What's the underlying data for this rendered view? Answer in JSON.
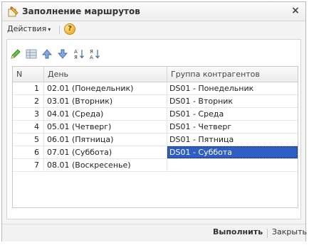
{
  "window": {
    "title": "Заполнение маршрутов",
    "close_glyph": "×",
    "icon": "route-fill-icon"
  },
  "menu": {
    "actions_label": "Действия",
    "actions_caret": "▾",
    "help_glyph": "?"
  },
  "toolbar": {
    "icons": [
      "edit-pencil-icon",
      "grid-icon",
      "move-up-icon",
      "move-down-icon",
      "sort-ascending-icon",
      "sort-descending-icon"
    ]
  },
  "table": {
    "columns": [
      "N",
      "День",
      "Группа контрагентов"
    ],
    "rows": [
      {
        "n": "1",
        "day": "02.01 (Понедельник)",
        "group": "DS01 - Понедельник"
      },
      {
        "n": "2",
        "day": "03.01 (Вторник)",
        "group": "DS01 - Вторник"
      },
      {
        "n": "3",
        "day": "04.01 (Среда)",
        "group": "DS01 - Среда"
      },
      {
        "n": "4",
        "day": "05.01 (Четверг)",
        "group": "DS01 - Четверг"
      },
      {
        "n": "5",
        "day": "06.01 (Пятница)",
        "group": "DS01 - Пятница"
      },
      {
        "n": "6",
        "day": "07.01 (Суббота)",
        "group": "DS01 - Суббота"
      },
      {
        "n": "7",
        "day": "08.01 (Воскресенье)",
        "group": ""
      }
    ],
    "selected_row": 6
  },
  "footer": {
    "execute_label": "Выполнить",
    "close_label": "Закрыть"
  },
  "colors": {
    "selection": "#2f5ec4"
  }
}
